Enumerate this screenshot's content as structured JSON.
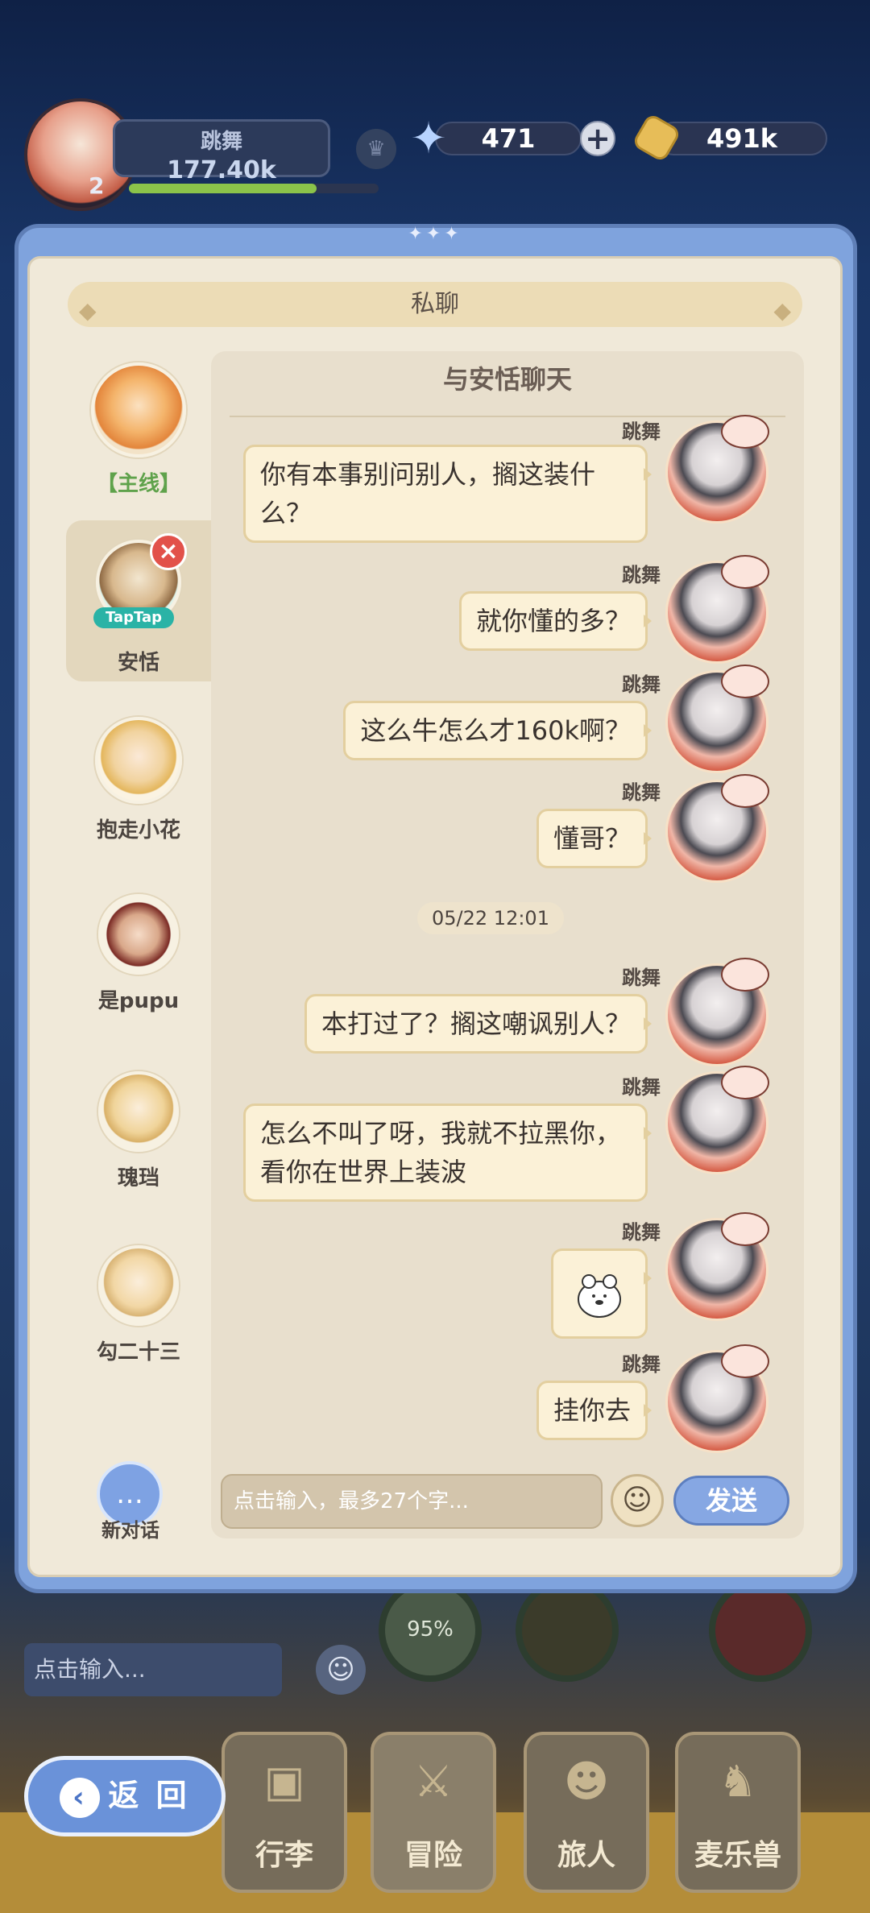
{
  "hud": {
    "name": "跳舞",
    "power": "177.40k",
    "level": "2",
    "level_progress": 0.75,
    "gems": "471",
    "gold": "491k"
  },
  "panel": {
    "title": "私聊"
  },
  "sidebar": {
    "items": [
      {
        "label": "【主线】"
      },
      {
        "label": "安恬",
        "badge": "TapTap"
      },
      {
        "label": "抱走小花"
      },
      {
        "label": "是pupu"
      },
      {
        "label": "瑰珰"
      },
      {
        "label": "勾二十三"
      }
    ],
    "new_chat": "新对话"
  },
  "chat": {
    "title": "与安恬聊天",
    "sender": "跳舞",
    "messages": [
      {
        "name": "跳舞",
        "text": "你有本事别问别人，搁这装什么？"
      },
      {
        "name": "跳舞",
        "text": "就你懂的多？"
      },
      {
        "name": "跳舞",
        "text": "这么牛怎么才160k啊？"
      },
      {
        "name": "跳舞",
        "text": "懂哥？"
      },
      {
        "name": "跳舞",
        "text": "本打过了？搁这嘲讽别人？"
      },
      {
        "name": "跳舞",
        "text": "怎么不叫了呀，我就不拉黑你，看你在世界上装波"
      },
      {
        "name": "跳舞",
        "sticker": "bear-sticker"
      },
      {
        "name": "跳舞",
        "text": "挂你去"
      }
    ],
    "date": "05/22  12:01",
    "input_placeholder": "点击输入，最多27个字...",
    "send": "发送"
  },
  "bottom": {
    "input_placeholder": "点击输入...",
    "progress": "95%",
    "back": "返 回",
    "tabs": [
      "行李",
      "冒险",
      "旅人",
      "麦乐兽"
    ]
  }
}
